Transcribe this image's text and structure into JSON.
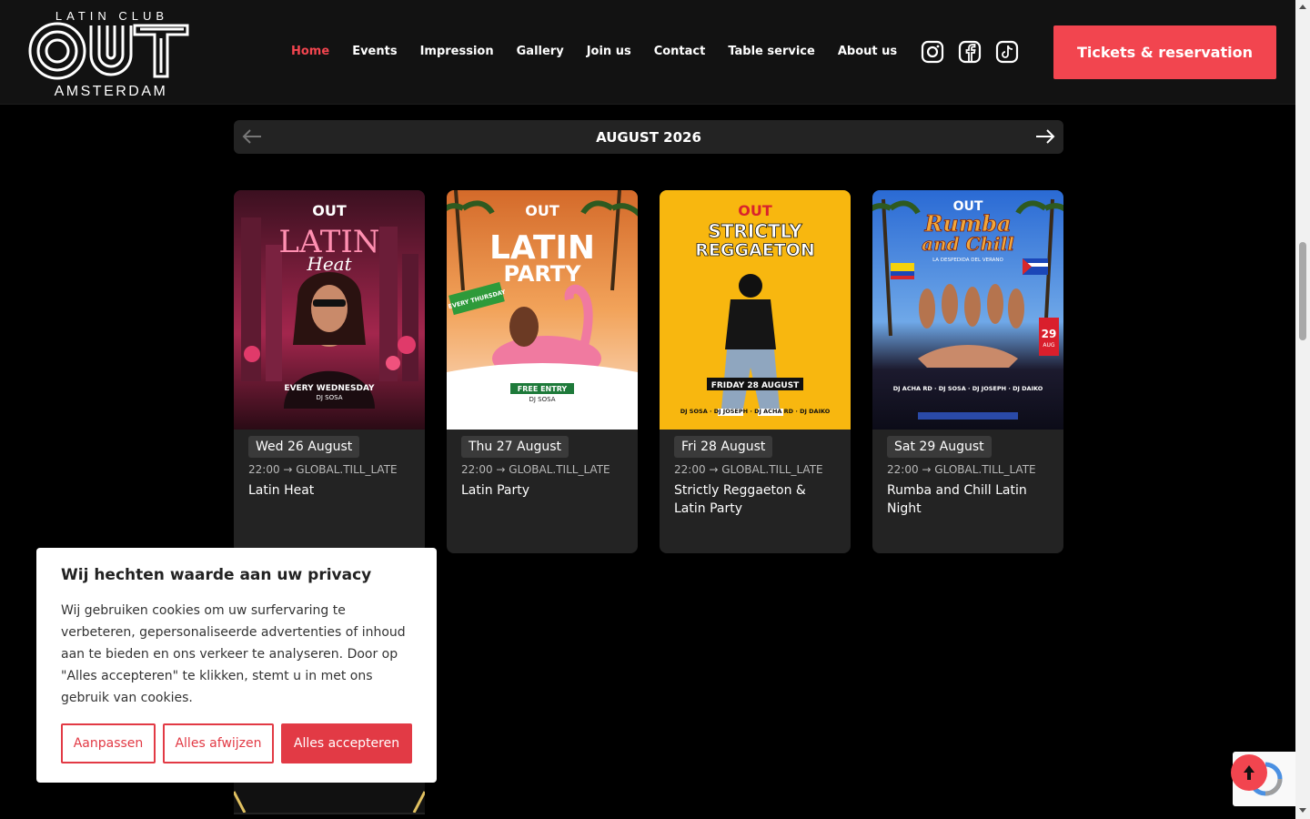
{
  "logo": {
    "top": "LATIN CLUB",
    "main": "OUT",
    "bottom": "AMSTERDAM"
  },
  "nav": {
    "items": [
      {
        "label": "Home",
        "active": true
      },
      {
        "label": "Events"
      },
      {
        "label": "Impression"
      },
      {
        "label": "Gallery"
      },
      {
        "label": "Join us"
      },
      {
        "label": "Contact"
      },
      {
        "label": "Table service"
      },
      {
        "label": "About us"
      }
    ],
    "socials": [
      "instagram-icon",
      "facebook-icon",
      "tiktok-icon"
    ],
    "cta_label": "Tickets & reservation"
  },
  "calendar": {
    "month": "AUGUST 2026"
  },
  "events": [
    {
      "date": "Wed 26 August",
      "time": "22:00 → GLOBAL.TILL_LATE",
      "title": "Latin Heat"
    },
    {
      "date": "Thu 27 August",
      "time": "22:00 → GLOBAL.TILL_LATE",
      "title": "Latin Party"
    },
    {
      "date": "Fri 28 August",
      "time": "22:00 → GLOBAL.TILL_LATE",
      "title": "Strictly Reggaeton & Latin Party"
    },
    {
      "date": "Sat 29 August",
      "time": "22:00 → GLOBAL.TILL_LATE",
      "title": "Rumba and Chill Latin Night"
    }
  ],
  "posters": {
    "p1": {
      "brand": "OUT",
      "line1": "LATIN",
      "line2": "Heat",
      "footer": "EVERY WEDNESDAY",
      "dj": "DJ SOSA"
    },
    "p2": {
      "brand": "OUT",
      "line1": "LATIN",
      "line2": "PARTY",
      "tag": "EVERY THURSDAY",
      "footer": "FREE ENTRY",
      "dj": "DJ SOSA"
    },
    "p3": {
      "brand": "OUT",
      "line1": "STRICTLY",
      "line2": "REGGAETON",
      "footer": "FRIDAY 28 AUGUST",
      "djs": "DJ SOSA · DJ JOSEPH · DJ ACHA RD · DJ DAIKO"
    },
    "p4": {
      "brand": "OUT",
      "line1": "Rumba",
      "line2": "and Chill",
      "sub": "LA DESPEDIDA DEL VERANO",
      "day": "29",
      "month": "AUG",
      "djs": "DJ ACHA RD · DJ SOSA · DJ JOSEPH · DJ DAIKO"
    }
  },
  "cookie": {
    "title": "Wij hechten waarde aan uw privacy",
    "text": "Wij gebruiken cookies om uw surfervaring te verbeteren, gepersonaliseerde advertenties of inhoud aan te bieden en ons verkeer te analyseren. Door op \"Alles accepteren\" te klikken, stemt u in met ons gebruik van cookies.",
    "customize": "Aanpassen",
    "reject": "Alles afwijzen",
    "accept": "Alles accepteren"
  },
  "colors": {
    "accent": "#f2454f",
    "header_bg": "#121212",
    "card_bg": "#232323"
  }
}
